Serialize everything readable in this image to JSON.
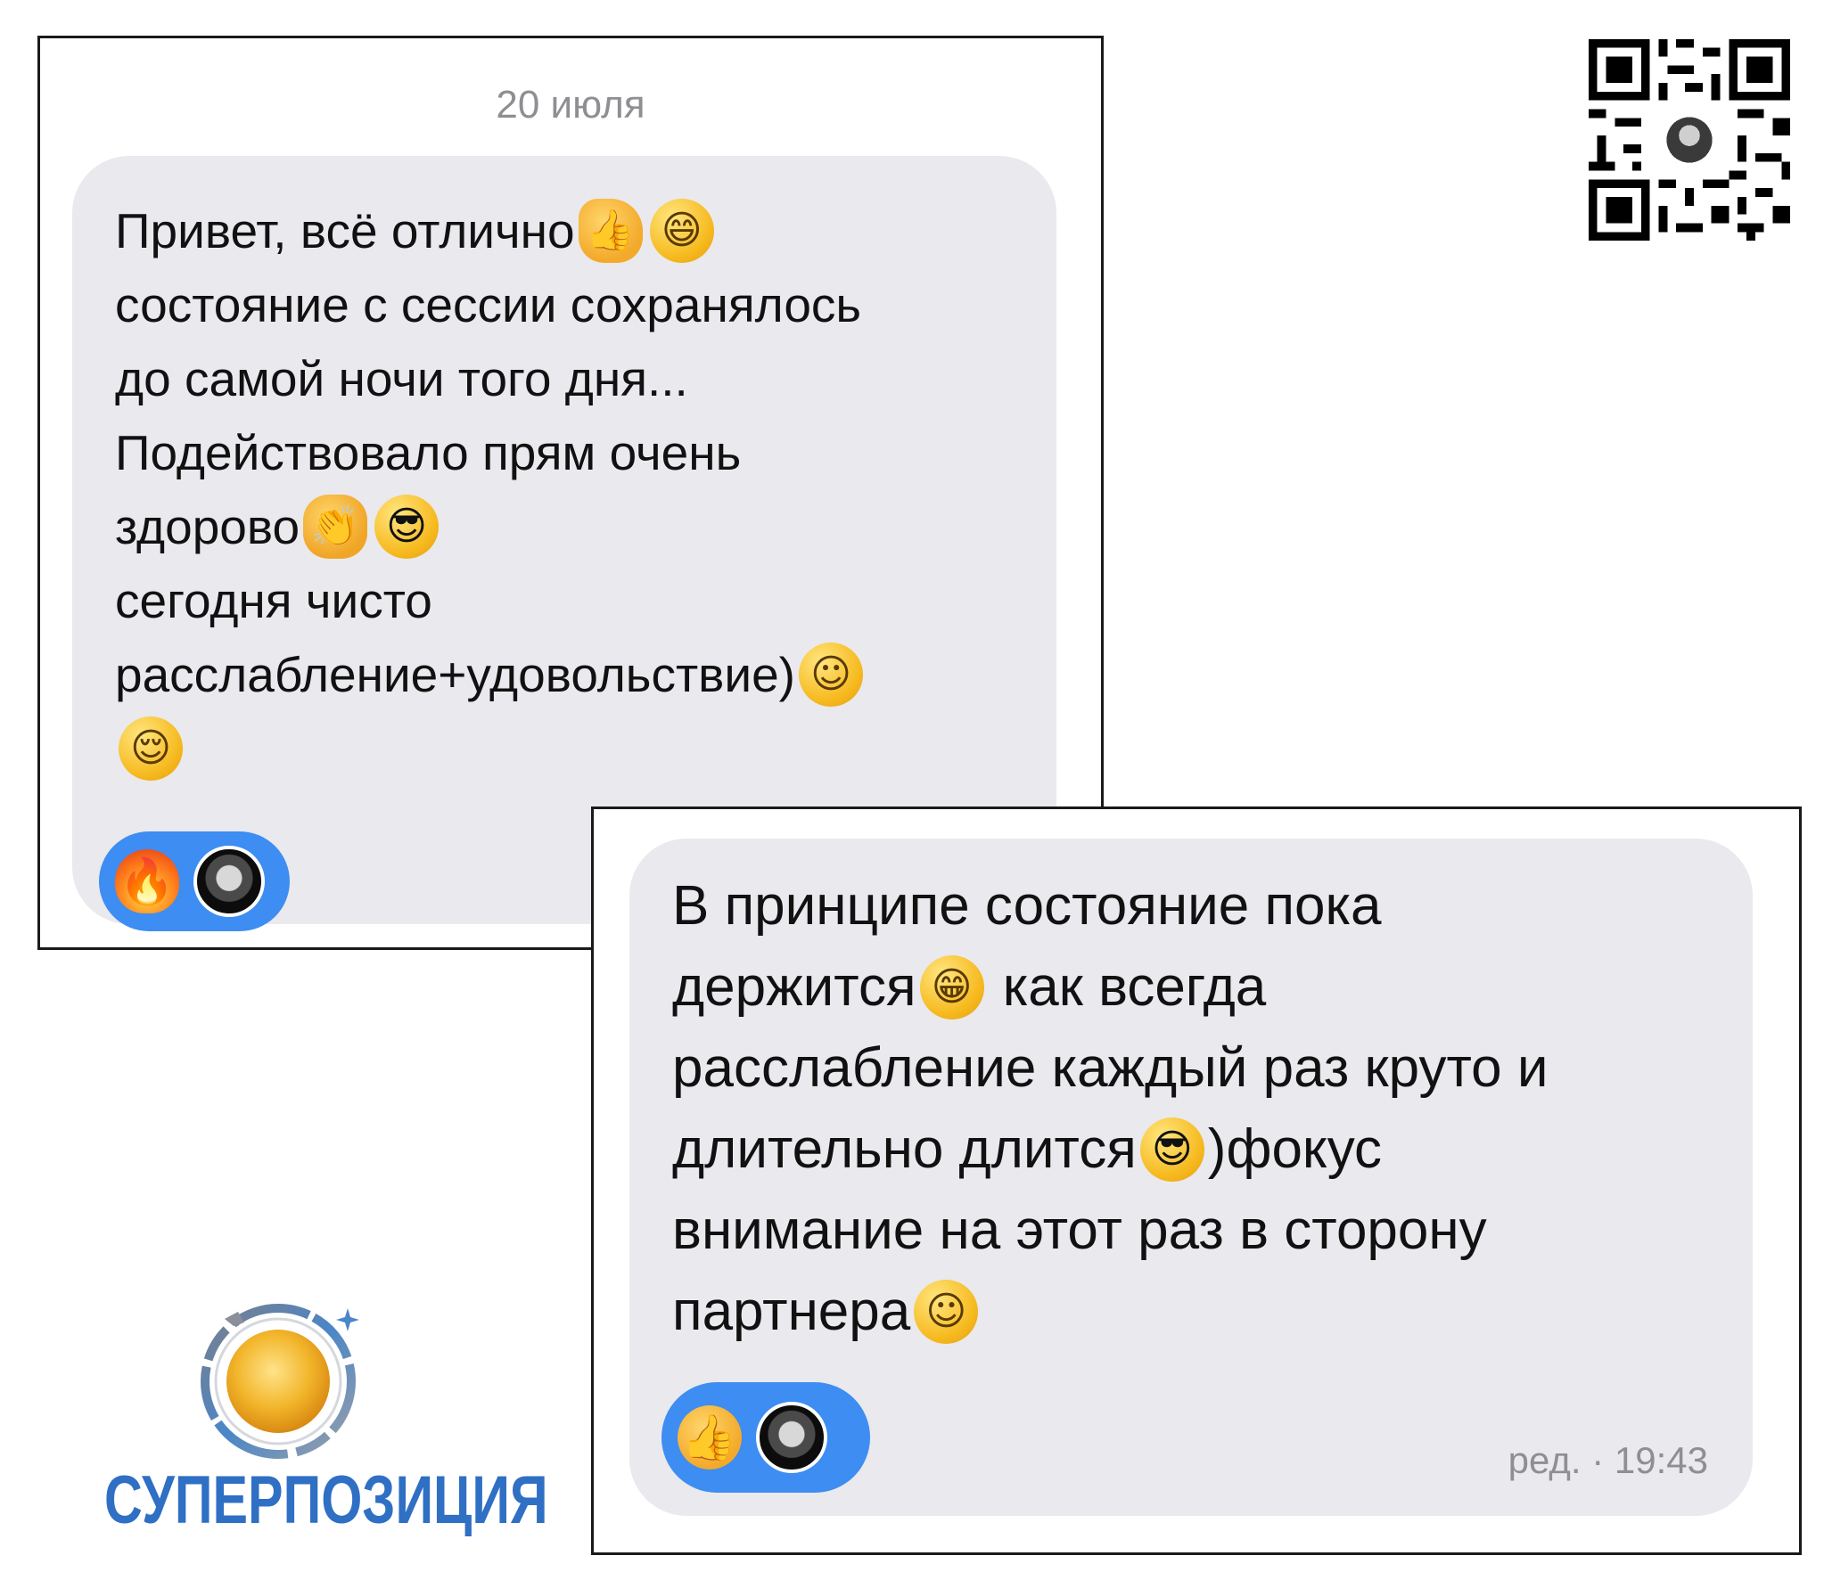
{
  "date_label": "20 июля",
  "message_1": {
    "lines": [
      {
        "text": "Привет, всё отлично",
        "emojis": [
          "👍",
          "😄"
        ]
      },
      {
        "text": "состояние с сессии сохранялось",
        "emojis": []
      },
      {
        "text": "до самой ночи того дня...",
        "emojis": []
      },
      {
        "text": "Подействовало прям очень",
        "emojis": []
      },
      {
        "text": "здорово",
        "emojis": [
          "👏",
          "😎"
        ]
      },
      {
        "text": "сегодня чисто",
        "emojis": []
      },
      {
        "text": "расслабление+удовольствие) ",
        "emojis": [
          "☺"
        ]
      },
      {
        "text": "",
        "emojis": [
          "😌"
        ]
      }
    ],
    "reaction_emoji": "🔥"
  },
  "message_2": {
    "lines": [
      {
        "text": "В принципе состояние пока",
        "emojis": []
      },
      {
        "text": "держится",
        "emojis": [
          "😁"
        ],
        "after": " как всегда"
      },
      {
        "text": "расслабление каждый раз круто и",
        "emojis": []
      },
      {
        "text": "длительно длится",
        "emojis": [
          "😎"
        ],
        "after": ")фокус"
      },
      {
        "text": "внимание на этот раз в сторону",
        "emojis": []
      },
      {
        "text": "партнера",
        "emojis": [
          "☺"
        ]
      }
    ],
    "reaction_emoji": "👍",
    "timestamp": "ред. · 19:43"
  },
  "logo": {
    "text": "СУПЕРПОЗИЦИЯ",
    "color": "#2f6fc4"
  },
  "colors": {
    "bubble": "#e9e9ee",
    "reaction": "#3d8df2",
    "meta_text": "#8e8e93"
  }
}
